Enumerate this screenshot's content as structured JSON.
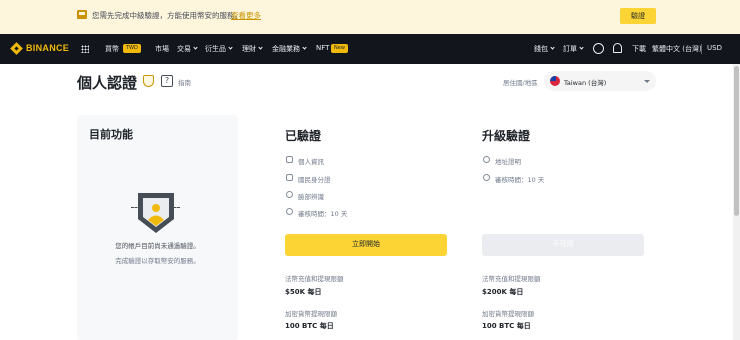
{
  "banner": {
    "text": "您需先完成中級驗證，方能使用幣安的服務。",
    "link": "查看更多",
    "button": "驗證"
  },
  "nav": {
    "brand": "BINANCE",
    "items": [
      {
        "label": "買幣",
        "tag": "TWD",
        "chevron": true
      },
      {
        "label": "市場",
        "tag": "",
        "chevron": false
      },
      {
        "label": "交易",
        "tag": "",
        "chevron": true
      },
      {
        "label": "衍生品",
        "tag": "",
        "chevron": true
      },
      {
        "label": "理財",
        "tag": "",
        "chevron": true
      },
      {
        "label": "金融業務",
        "tag": "",
        "chevron": true
      },
      {
        "label": "NFT",
        "tag": "New",
        "chevron": false
      }
    ],
    "right": {
      "wallet": "錢包",
      "orders": "訂單",
      "download": "下載",
      "language": "繁體中文 (台灣)",
      "currency": "USD"
    }
  },
  "header": {
    "title": "個人認證",
    "guide": "指南",
    "help_glyph": "?",
    "region_label": "居住國/地區",
    "region_value": "Taiwan (台灣)"
  },
  "current": {
    "title": "目前功能",
    "note1": "您的帳戶目前尚未通過驗證。",
    "note2": "完成驗證以存取幣安的服務。"
  },
  "verified": {
    "title": "已驗證",
    "features": [
      "個人資訊",
      "國民身分證",
      "臉部辨識",
      "審核時間：10 天"
    ],
    "button": "立即開始",
    "limit1_label": "法幣充值和提現限額",
    "limit1_value": "$50K 每日",
    "limit2_label": "加密貨幣提現限額",
    "limit2_value": "100 BTC 每日"
  },
  "upgrade": {
    "title": "升級驗證",
    "features": [
      "地址證明",
      "審核時間：10 天"
    ],
    "button": "不可用",
    "limit1_label": "法幣充值和提現限額",
    "limit1_value": "$200K 每日",
    "limit2_label": "加密貨幣提現限額",
    "limit2_value": "100 BTC 每日"
  },
  "colors": {
    "brand_yellow": "#fcd535",
    "nav_bg": "#12161c",
    "banner_bg": "#fdf5dc"
  }
}
